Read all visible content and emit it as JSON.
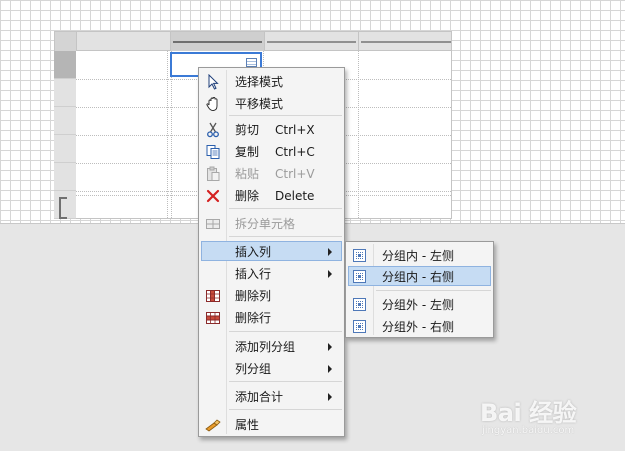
{
  "context_menu": {
    "items": [
      {
        "label": "选择模式",
        "shortcut": "",
        "icon": "pointer-icon"
      },
      {
        "label": "平移模式",
        "shortcut": "",
        "icon": "pan-hand-icon"
      },
      {
        "label": "剪切",
        "shortcut": "Ctrl+X",
        "icon": "cut-icon"
      },
      {
        "label": "复制",
        "shortcut": "Ctrl+C",
        "icon": "copy-icon"
      },
      {
        "label": "粘贴",
        "shortcut": "Ctrl+V",
        "icon": "paste-icon",
        "disabled": true
      },
      {
        "label": "删除",
        "shortcut": "Delete",
        "icon": "delete-x-icon"
      },
      {
        "label": "拆分单元格",
        "shortcut": "",
        "icon": "split-cell-icon",
        "disabled": true
      },
      {
        "label": "插入列",
        "shortcut": "",
        "submenu": true,
        "highlighted": true
      },
      {
        "label": "插入行",
        "shortcut": "",
        "submenu": true
      },
      {
        "label": "删除列",
        "shortcut": "",
        "icon": "delete-column-icon"
      },
      {
        "label": "删除行",
        "shortcut": "",
        "icon": "delete-row-icon"
      },
      {
        "label": "添加列分组",
        "shortcut": "",
        "submenu": true
      },
      {
        "label": "列分组",
        "shortcut": "",
        "submenu": true
      },
      {
        "label": "添加合计",
        "shortcut": "",
        "submenu": true
      },
      {
        "label": "属性",
        "shortcut": "",
        "icon": "properties-icon"
      }
    ]
  },
  "submenu": {
    "items": [
      {
        "label": "分组内 - 左侧",
        "icon": "group-inner-left-icon"
      },
      {
        "label": "分组内 - 右侧",
        "icon": "group-inner-right-icon",
        "highlighted": true
      },
      {
        "label": "分组外 - 左侧",
        "icon": "group-outer-left-icon"
      },
      {
        "label": "分组外 - 右侧",
        "icon": "group-outer-right-icon"
      }
    ]
  },
  "watermark": {
    "main": "Bai 经验",
    "sub": "jingyan.baidu.com"
  },
  "colors": {
    "highlight": "#c6dcf3",
    "highlight_border": "#8fb3e0",
    "selection": "#3b7ad6",
    "menu_bg": "#f4f4f4",
    "delete_red": "#d42020"
  }
}
